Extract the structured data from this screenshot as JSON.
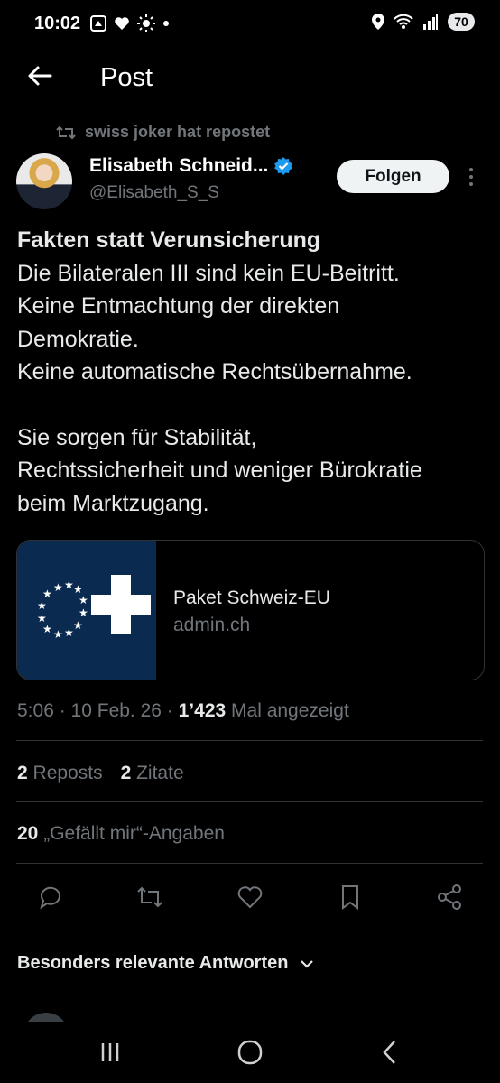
{
  "status": {
    "time": "10:02",
    "battery": "70"
  },
  "header": {
    "title": "Post"
  },
  "repost": {
    "label": "swiss joker hat repostet"
  },
  "author": {
    "name": "Elisabeth Schneid...",
    "handle": "@Elisabeth_S_S",
    "follow_label": "Folgen"
  },
  "tweet": {
    "headline": "Fakten statt Verunsicherung",
    "lines1": [
      "Die Bilateralen III sind kein EU-Beitritt.",
      "Keine Entmachtung der direkten",
      "Demokratie.",
      "Keine automatische Rechtsübernahme."
    ],
    "lines2": [
      "Sie sorgen für Stabilität,",
      "Rechtssicherheit und weniger Bürokratie",
      "beim Marktzugang."
    ]
  },
  "card": {
    "title": "Paket Schweiz-EU",
    "domain": "admin.ch"
  },
  "meta": {
    "time": "5:06",
    "date": "10 Feb. 26",
    "views_count": "1’423",
    "views_label": "Mal angezeigt"
  },
  "stats": {
    "reposts_count": "2",
    "reposts_label": "Reposts",
    "quotes_count": "2",
    "quotes_label": "Zitate",
    "likes_count": "20",
    "likes_label": "„Gefällt mir“-Angaben"
  },
  "replies": {
    "sort_label": "Besonders relevante Antworten"
  },
  "colors": {
    "accent_verified": "#1d9bf0",
    "eu_blue": "#0a2a4f",
    "muted": "#71767b"
  }
}
